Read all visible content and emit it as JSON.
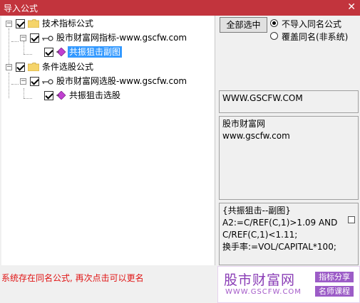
{
  "window": {
    "title": "导入公式",
    "close_label": "✕"
  },
  "tree": {
    "nodes": [
      {
        "label": "技术指标公式"
      },
      {
        "label": "股市财富网指标-www.gscfw.com"
      },
      {
        "label": "共振狙击副图"
      },
      {
        "label": "条件选股公式"
      },
      {
        "label": "股市财富网选股-www.gscfw.com"
      },
      {
        "label": "共振狙击选股"
      }
    ]
  },
  "options": {
    "select_all_label": "全部选中",
    "radio_skip_label": "不导入同名公式",
    "radio_overwrite_label": "覆盖同名(非系统)"
  },
  "panels": {
    "url_line": "WWW.GSCFW.COM",
    "desc_line1": "股市财富网",
    "desc_line2": "www.gscfw.com",
    "formula_line1": "{共振狙击--副图}",
    "formula_line2": "A2:=C/REF(C,1)>1.09 AND",
    "formula_line3": "C/REF(C,1)<1.11;",
    "formula_line4": "换手率:=VOL/CAPITAL*100;"
  },
  "status": {
    "message": "系统存在同名公式, 再次点击可以更名"
  },
  "watermark": {
    "main": "股市财富网",
    "url": "WWW.GSCFW.COM",
    "tag1": "指标分享",
    "tag2": "名师课程"
  },
  "colors": {
    "titlebar": "#c2343d",
    "selection": "#3399ff",
    "status_text": "#e01515",
    "watermark_purple": "#8a3db6"
  }
}
